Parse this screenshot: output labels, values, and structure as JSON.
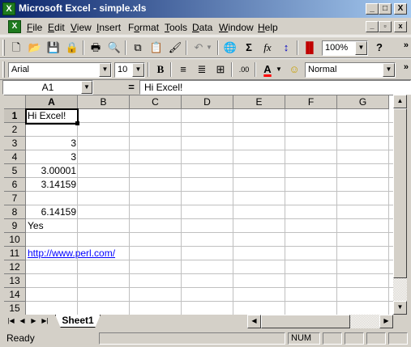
{
  "window": {
    "title": "Microsoft Excel - simple.xls",
    "minimize": "_",
    "maximize": "□",
    "close": "X"
  },
  "menu": {
    "items": [
      {
        "hot": "F",
        "rest": "ile"
      },
      {
        "hot": "E",
        "rest": "dit"
      },
      {
        "hot": "V",
        "rest": "iew"
      },
      {
        "hot": "I",
        "rest": "nsert"
      },
      {
        "pre": "F",
        "hot": "o",
        "rest": "rmat"
      },
      {
        "hot": "T",
        "rest": "ools"
      },
      {
        "hot": "D",
        "rest": "ata"
      },
      {
        "hot": "W",
        "rest": "indow"
      },
      {
        "hot": "H",
        "rest": "elp"
      }
    ]
  },
  "toolbar": {
    "zoom": "100%",
    "font_name": "Arial",
    "font_size": "10",
    "style": "Normal",
    "bold": "B",
    "sigma": "Σ",
    "fx": "fx",
    "help": "?",
    "more": "»"
  },
  "formula_bar": {
    "name_box": "A1",
    "equals": "=",
    "content": "Hi Excel!"
  },
  "sheet": {
    "columns": [
      "A",
      "B",
      "C",
      "D",
      "E",
      "F",
      "G"
    ],
    "rows": [
      "1",
      "2",
      "3",
      "4",
      "5",
      "6",
      "7",
      "8",
      "9",
      "10",
      "11",
      "12",
      "13",
      "14",
      "15"
    ],
    "cells": {
      "A1": "Hi Excel!",
      "A3": "3",
      "A4": "3",
      "A5": "3.00001",
      "A6": "3.14159",
      "A8": "6.14159",
      "A9": "Yes",
      "A11": "http://www.perl.com/"
    },
    "active_cell": "A1",
    "tabs": [
      "Sheet1"
    ]
  },
  "status": {
    "text": "Ready",
    "num": "NUM"
  },
  "colors": {
    "title_start": "#0a246a",
    "title_end": "#a6caf0",
    "face": "#d4d0c8",
    "link": "#0000ff"
  }
}
